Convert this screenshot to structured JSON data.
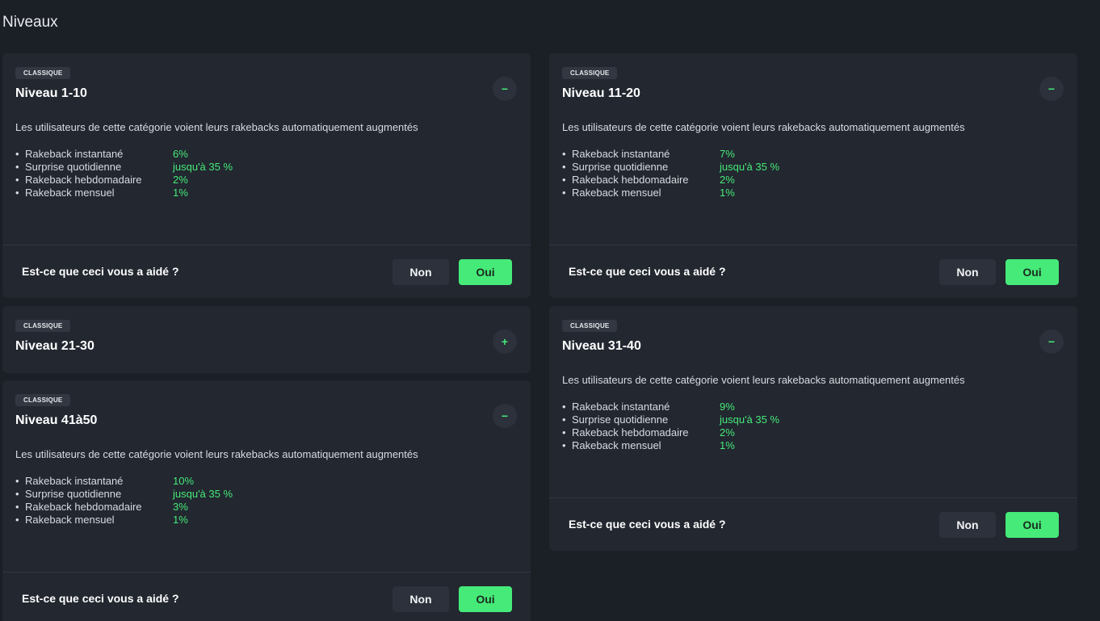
{
  "page": {
    "title": "Niveaux"
  },
  "common": {
    "badge": "CLASSIQUE",
    "description": "Les utilisateurs de cette catégorie voient leurs rakebacks automatiquement augmentés",
    "feedback_question": "Est-ce que ceci vous a aidé ?",
    "no_label": "Non",
    "yes_label": "Oui",
    "collapse_symbol": "−",
    "expand_symbol": "+",
    "bullet": "•",
    "benefit_labels": {
      "instant": "Rakeback instantané",
      "daily": "Surprise quotidienne",
      "weekly": "Rakeback hebdomadaire",
      "monthly": "Rakeback mensuel"
    }
  },
  "levels": [
    {
      "title": "Niveau 1-10",
      "expanded": true,
      "values": {
        "instant": "6%",
        "daily": "jusqu'à 35 %",
        "weekly": "2%",
        "monthly": "1%"
      }
    },
    {
      "title": "Niveau 11-20",
      "expanded": true,
      "values": {
        "instant": "7%",
        "daily": "jusqu'à 35 %",
        "weekly": "2%",
        "monthly": "1%"
      }
    },
    {
      "title": "Niveau 21-30",
      "expanded": false
    },
    {
      "title": "Niveau 31-40",
      "expanded": true,
      "values": {
        "instant": "9%",
        "daily": "jusqu'à 35 %",
        "weekly": "2%",
        "monthly": "1%"
      }
    },
    {
      "title": "Niveau 41à50",
      "expanded": true,
      "values": {
        "instant": "10%",
        "daily": "jusqu'à 35 %",
        "weekly": "3%",
        "monthly": "1%"
      }
    }
  ],
  "colors": {
    "background": "#1b1f26",
    "card": "#222730",
    "accent": "#46ea78",
    "button_dark": "#2c313b"
  }
}
